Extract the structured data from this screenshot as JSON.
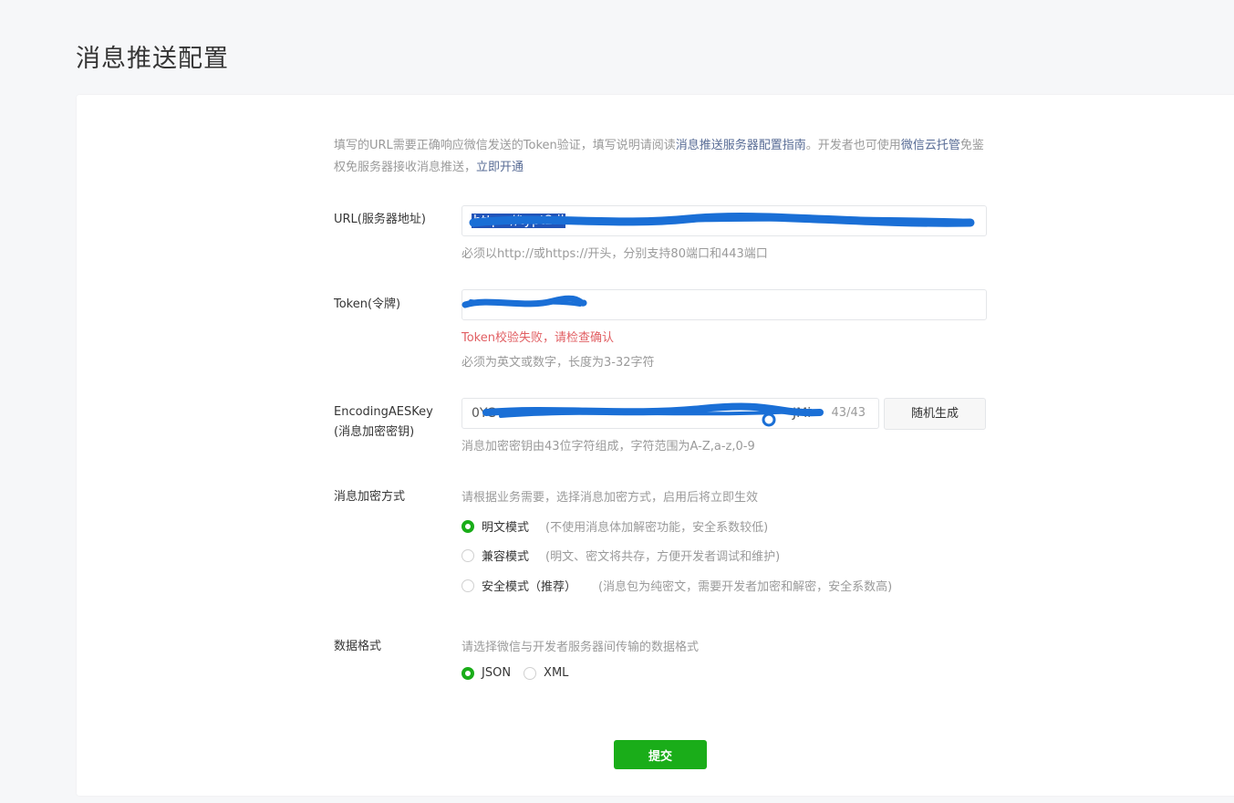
{
  "page": {
    "title": "消息推送配置"
  },
  "intro": {
    "text1": "填写的URL需要正确响应微信发送的Token验证，填写说明请阅读",
    "link1": "消息推送服务器配置指南",
    "text2": "。开发者也可使用",
    "link2": "微信云托管",
    "text3": "免鉴权免服务器接收消息推送，",
    "link3": "立即开通"
  },
  "url": {
    "label": "URL(服务器地址)",
    "value": "https://typt2.il",
    "hint": "必须以http://或https://开头，分别支持80端口和443端口"
  },
  "token": {
    "label": "Token(令牌)",
    "error": "Token校验失败，请检查确认",
    "hint": "必须为英文或数字，长度为3-32字符"
  },
  "aes": {
    "label_line1": "EncodingAESKey",
    "label_line2": "(消息加密密钥)",
    "value_prefix": "0YC",
    "value_suffix": "JMi",
    "counter": "43/43",
    "generate_label": "随机生成",
    "hint": "消息加密密钥由43位字符组成，字符范围为A-Z,a-z,0-9"
  },
  "encryption": {
    "label": "消息加密方式",
    "hint": "请根据业务需要，选择消息加密方式，启用后将立即生效",
    "options": [
      {
        "label": "明文模式",
        "desc": "(不使用消息体加解密功能，安全系数较低)",
        "selected": true
      },
      {
        "label": "兼容模式",
        "desc": "(明文、密文将共存，方便开发者调试和维护)",
        "selected": false
      },
      {
        "label": "安全模式（推荐）",
        "desc": "(消息包为纯密文，需要开发者加密和解密，安全系数高)",
        "selected": false
      }
    ]
  },
  "format": {
    "label": "数据格式",
    "hint": "请选择微信与开发者服务器间传输的数据格式",
    "options": [
      {
        "label": "JSON",
        "selected": true
      },
      {
        "label": "XML",
        "selected": false
      }
    ]
  },
  "submit_label": "提交",
  "colors": {
    "accent": "#1aad19",
    "link": "#576b95",
    "error": "#e15f63",
    "redaction": "#1a6fd6"
  }
}
